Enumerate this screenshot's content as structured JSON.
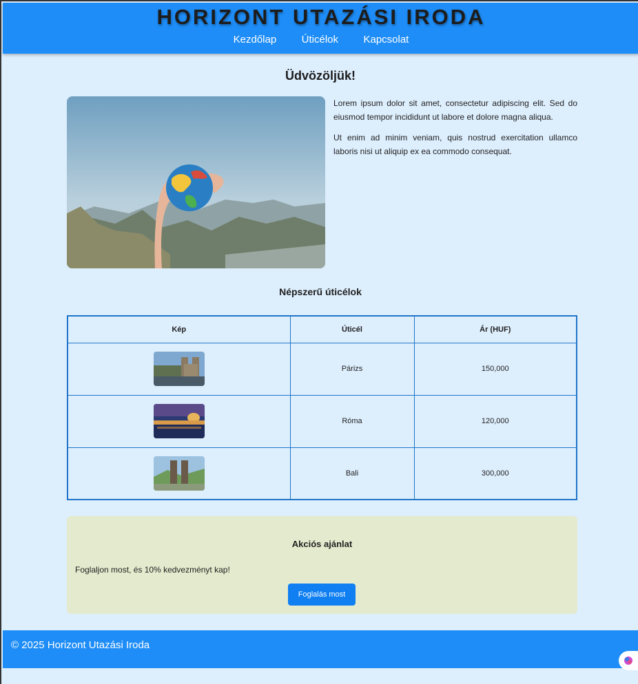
{
  "header": {
    "title": "HORIZONT UTAZÁSI IRODA",
    "nav": [
      "Kezdőlap",
      "Úticélok",
      "Kapcsolat"
    ]
  },
  "welcome": {
    "heading": "Üdvözöljük!",
    "paragraphs": [
      "Lorem ipsum dolor sit amet, consectetur adipiscing elit. Sed do eiusmod tempor incididunt ut labore et dolore magna aliqua.",
      "Ut enim ad minim veniam, quis nostrud exercitation ullamco laboris nisi ut aliquip ex ea commodo consequat."
    ]
  },
  "popular": {
    "title": "Népszerű úticélok",
    "columns": [
      "Kép",
      "Úticél",
      "Ár (HUF)"
    ],
    "rows": [
      {
        "destination": "Párizs",
        "price": "150,000"
      },
      {
        "destination": "Róma",
        "price": "120,000"
      },
      {
        "destination": "Bali",
        "price": "300,000"
      }
    ]
  },
  "offer": {
    "title": "Akciós ajánlat",
    "text": "Foglaljon most, és 10% kedvezményt kap!",
    "button": "Foglalás most"
  },
  "footer": {
    "text": "© 2025 Horizont Utazási Iroda"
  },
  "colors": {
    "header_bg": "#1e8df7",
    "page_bg": "#ddeefd",
    "offer_bg": "#e4eacd",
    "button_bg": "#0f7ff2",
    "table_border": "#1f74c9"
  }
}
